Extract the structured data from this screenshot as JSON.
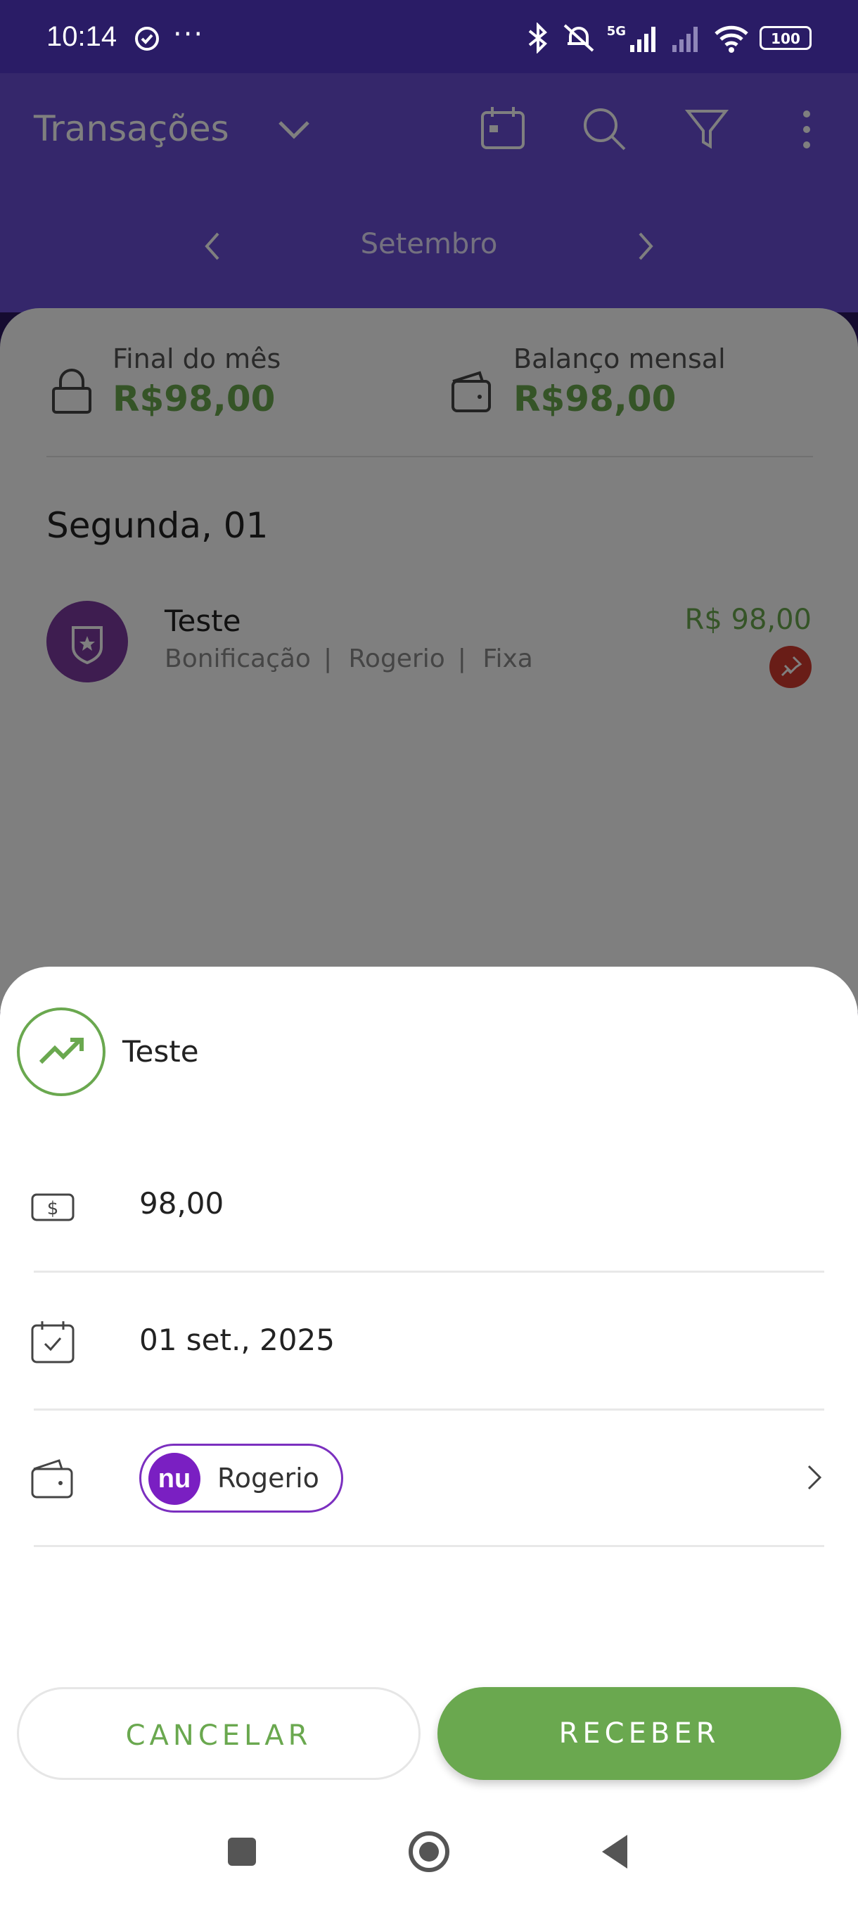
{
  "status_bar": {
    "time": "10:14",
    "signal_label": "5G",
    "battery": "100",
    "icons": [
      "check-circle-icon",
      "more-dots-icon",
      "bluetooth-icon",
      "mute-icon",
      "signal-icon",
      "signal-off-icon",
      "wifi-icon",
      "battery-icon"
    ]
  },
  "header": {
    "title": "Transações",
    "month": "Setembro"
  },
  "summary": {
    "end_of_month_label": "Final do mês",
    "end_of_month_value": "R$98,00",
    "monthly_balance_label": "Balanço mensal",
    "monthly_balance_value": "R$98,00"
  },
  "day_group": {
    "title": "Segunda, 01",
    "transaction": {
      "title": "Teste",
      "category": "Bonificação",
      "account": "Rogerio",
      "type": "Fixa",
      "amount": "R$ 98,00"
    }
  },
  "sheet": {
    "title": "Teste",
    "amount": "98,00",
    "date": "01 set., 2025",
    "account_logo": "nu",
    "account_name": "Rogerio",
    "cancel_label": "CANCELAR",
    "receive_label": "RECEBER"
  },
  "colors": {
    "primary_purple": "#6a4fd6",
    "green": "#6aa84f",
    "nubank_purple": "#7a1fc2"
  }
}
